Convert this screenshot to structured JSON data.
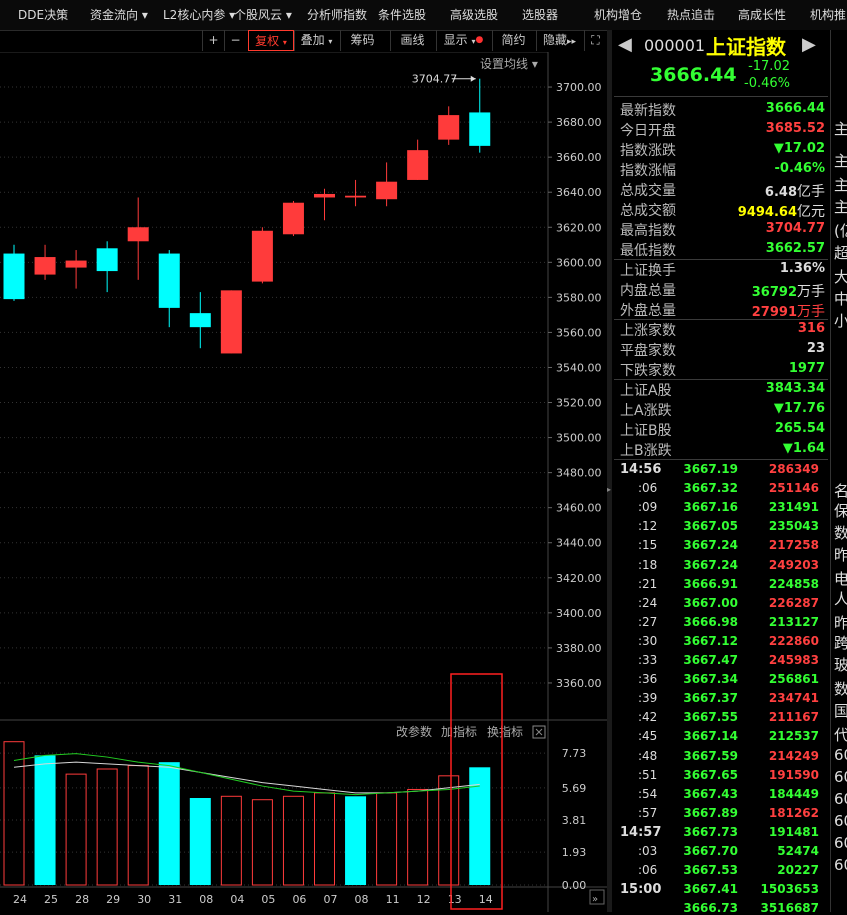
{
  "menu": [
    "DDE决策",
    "资金流向",
    "L2核心内参",
    "个股风云",
    "分析师指数",
    "条件选股",
    "高级选股",
    "选股器",
    "机构增仓",
    "热点追击",
    "高成长性",
    "机构推"
  ],
  "toolbar": {
    "plus": "+",
    "minus": "−",
    "fuquan": "复权",
    "diejia": "叠加",
    "chouma": "筹码",
    "huaxian": "画线",
    "xianshi": "显示",
    "jianyue": "简约",
    "yincang": "隐藏"
  },
  "chart_header": {
    "ma_setting": "设置均线"
  },
  "indicator_header": {
    "param": "改参数",
    "add": "加指标",
    "change": "换指标"
  },
  "colors": {
    "up": "#ff3b3b",
    "down": "#00ffff",
    "bg": "#000000",
    "grid": "#333333",
    "ma1": "#d8d8d8",
    "ma2": "#22cc22",
    "highlight": "#ff2020"
  },
  "chart_data": {
    "type": "candlestick",
    "price_axis": {
      "min": 3340,
      "max": 3720,
      "ticks": [
        "3700.00",
        "3680.00",
        "3660.00",
        "3640.00",
        "3620.00",
        "3600.00",
        "3580.00",
        "3560.00",
        "3540.00",
        "3520.00",
        "3500.00",
        "3480.00",
        "3460.00",
        "3440.00",
        "3420.00",
        "3400.00",
        "3380.00",
        "3360.00"
      ]
    },
    "x_labels": [
      "24",
      "25",
      "28",
      "29",
      "30",
      "31",
      "08",
      "04",
      "05",
      "06",
      "07",
      "08",
      "11",
      "12",
      "13",
      "14"
    ],
    "candles": [
      {
        "o": 3605,
        "h": 3610,
        "l": 3578,
        "c": 3579
      },
      {
        "o": 3593,
        "h": 3610,
        "l": 3590,
        "c": 3603
      },
      {
        "o": 3597,
        "h": 3607,
        "l": 3585,
        "c": 3601
      },
      {
        "o": 3608,
        "h": 3612,
        "l": 3583,
        "c": 3595
      },
      {
        "o": 3612,
        "h": 3637,
        "l": 3590,
        "c": 3620
      },
      {
        "o": 3605,
        "h": 3607,
        "l": 3563,
        "c": 3574
      },
      {
        "o": 3571,
        "h": 3583,
        "l": 3551,
        "c": 3563
      },
      {
        "o": 3548,
        "h": 3584,
        "l": 3548,
        "c": 3584
      },
      {
        "o": 3589,
        "h": 3620,
        "l": 3588,
        "c": 3618
      },
      {
        "o": 3616,
        "h": 3635,
        "l": 3615,
        "c": 3634
      },
      {
        "o": 3637,
        "h": 3642,
        "l": 3624,
        "c": 3639
      },
      {
        "o": 3637,
        "h": 3647,
        "l": 3632,
        "c": 3638
      },
      {
        "o": 3636,
        "h": 3657,
        "l": 3632,
        "c": 3646
      },
      {
        "o": 3647,
        "h": 3670,
        "l": 3647,
        "c": 3664
      },
      {
        "o": 3670,
        "h": 3689,
        "l": 3667,
        "c": 3684
      },
      {
        "o": 3685.52,
        "h": 3704.77,
        "l": 3662.57,
        "c": 3666.44
      }
    ],
    "high_annotation": "3704.77",
    "volume_axis": {
      "min": 0,
      "max": 8.5,
      "ticks": [
        "7.73",
        "5.69",
        "3.81",
        "1.93",
        "0.00"
      ]
    },
    "volumes": [
      {
        "v": 8.4,
        "dir": "up"
      },
      {
        "v": 7.6,
        "dir": "down"
      },
      {
        "v": 6.5,
        "dir": "up"
      },
      {
        "v": 6.8,
        "dir": "up"
      },
      {
        "v": 7.0,
        "dir": "up"
      },
      {
        "v": 7.2,
        "dir": "down"
      },
      {
        "v": 5.1,
        "dir": "down"
      },
      {
        "v": 5.2,
        "dir": "up"
      },
      {
        "v": 5.0,
        "dir": "up"
      },
      {
        "v": 5.2,
        "dir": "up"
      },
      {
        "v": 5.4,
        "dir": "up"
      },
      {
        "v": 5.2,
        "dir": "down"
      },
      {
        "v": 5.4,
        "dir": "up"
      },
      {
        "v": 5.6,
        "dir": "up"
      },
      {
        "v": 6.4,
        "dir": "up"
      },
      {
        "v": 6.9,
        "dir": "down"
      }
    ],
    "vol_ma1": [
      6.9,
      7.1,
      7.2,
      7.1,
      7.0,
      6.9,
      6.6,
      6.3,
      6.0,
      5.8,
      5.6,
      5.4,
      5.4,
      5.5,
      5.7,
      5.9
    ],
    "vol_ma2": [
      7.3,
      7.6,
      7.7,
      7.5,
      7.2,
      7.0,
      6.6,
      6.2,
      5.8,
      5.5,
      5.4,
      5.3,
      5.4,
      5.5,
      5.6,
      5.8
    ]
  },
  "quote": {
    "code": "000001",
    "name": "上证指数",
    "price": "3666.44",
    "change": "-17.02",
    "pct": "-0.46%",
    "rows": [
      {
        "label": "最新指数",
        "value": "3666.44",
        "color": "green"
      },
      {
        "label": "今日开盘",
        "value": "3685.52",
        "color": "red"
      },
      {
        "label": "指数涨跌",
        "value": "▼17.02",
        "color": "green"
      },
      {
        "label": "指数涨幅",
        "value": "-0.46%",
        "color": "green"
      },
      {
        "label": "总成交量",
        "value": "6.48",
        "unit": "亿手",
        "color": "white"
      },
      {
        "label": "总成交额",
        "value": "9494.64",
        "unit": "亿元",
        "color": "yellow"
      },
      {
        "label": "最高指数",
        "value": "3704.77",
        "color": "red"
      },
      {
        "label": "最低指数",
        "value": "3662.57",
        "color": "green"
      },
      {
        "label": "上证换手",
        "value": "1.36%",
        "color": "white"
      },
      {
        "label": "内盘总量",
        "value": "36792",
        "unit": "万手",
        "color": "green"
      },
      {
        "label": "外盘总量",
        "value": "27991",
        "unit": "万手",
        "color": "red"
      },
      {
        "label": "上涨家数",
        "value": "316",
        "color": "red"
      },
      {
        "label": "平盘家数",
        "value": "23",
        "color": "white"
      },
      {
        "label": "下跌家数",
        "value": "1977",
        "color": "green"
      },
      {
        "label": "上证A股",
        "value": "3843.34",
        "color": "green"
      },
      {
        "label": "上A涨跌",
        "value": "▼17.76",
        "color": "green"
      },
      {
        "label": "上证B股",
        "value": "265.54",
        "color": "green"
      },
      {
        "label": "上B涨跌",
        "value": "▼1.64",
        "color": "green"
      }
    ],
    "ticks": [
      {
        "t": "14:56",
        "p": "3667.19",
        "v": "286349",
        "vc": "red"
      },
      {
        "t": ":06",
        "p": "3667.32",
        "v": "251146",
        "vc": "red"
      },
      {
        "t": ":09",
        "p": "3667.16",
        "v": "231491",
        "vc": "green"
      },
      {
        "t": ":12",
        "p": "3667.05",
        "v": "235043",
        "vc": "green"
      },
      {
        "t": ":15",
        "p": "3667.24",
        "v": "217258",
        "vc": "red"
      },
      {
        "t": ":18",
        "p": "3667.24",
        "v": "249203",
        "vc": "red"
      },
      {
        "t": ":21",
        "p": "3666.91",
        "v": "224858",
        "vc": "green"
      },
      {
        "t": ":24",
        "p": "3667.00",
        "v": "226287",
        "vc": "red"
      },
      {
        "t": ":27",
        "p": "3666.98",
        "v": "213127",
        "vc": "green"
      },
      {
        "t": ":30",
        "p": "3667.12",
        "v": "222860",
        "vc": "red"
      },
      {
        "t": ":33",
        "p": "3667.47",
        "v": "245983",
        "vc": "red"
      },
      {
        "t": ":36",
        "p": "3667.34",
        "v": "256861",
        "vc": "green"
      },
      {
        "t": ":39",
        "p": "3667.37",
        "v": "234741",
        "vc": "red"
      },
      {
        "t": ":42",
        "p": "3667.55",
        "v": "211167",
        "vc": "red"
      },
      {
        "t": ":45",
        "p": "3667.14",
        "v": "212537",
        "vc": "green"
      },
      {
        "t": ":48",
        "p": "3667.59",
        "v": "214249",
        "vc": "red"
      },
      {
        "t": ":51",
        "p": "3667.65",
        "v": "191590",
        "vc": "red"
      },
      {
        "t": ":54",
        "p": "3667.43",
        "v": "184449",
        "vc": "green"
      },
      {
        "t": ":57",
        "p": "3667.89",
        "v": "181262",
        "vc": "red"
      },
      {
        "t": "14:57",
        "p": "3667.73",
        "v": "191481",
        "vc": "green"
      },
      {
        "t": ":03",
        "p": "3667.70",
        "v": "52474",
        "vc": "green"
      },
      {
        "t": ":06",
        "p": "3667.53",
        "v": "20227",
        "vc": "green"
      },
      {
        "t": "15:00",
        "p": "3667.41",
        "v": "1503653",
        "vc": "green"
      },
      {
        "t": "",
        "p": "3666.73",
        "v": "3516687",
        "vc": "green"
      }
    ],
    "edge_chars": [
      "主",
      "主",
      "主",
      "主",
      "(亿",
      "超",
      "大",
      "中",
      "小",
      "",
      "",
      "",
      "",
      "名",
      "保",
      "数",
      "昨",
      "电",
      "人",
      "昨",
      "跨",
      "玻",
      "数",
      "国",
      "代",
      "60",
      "60",
      "60",
      "60",
      "60",
      "60"
    ]
  }
}
